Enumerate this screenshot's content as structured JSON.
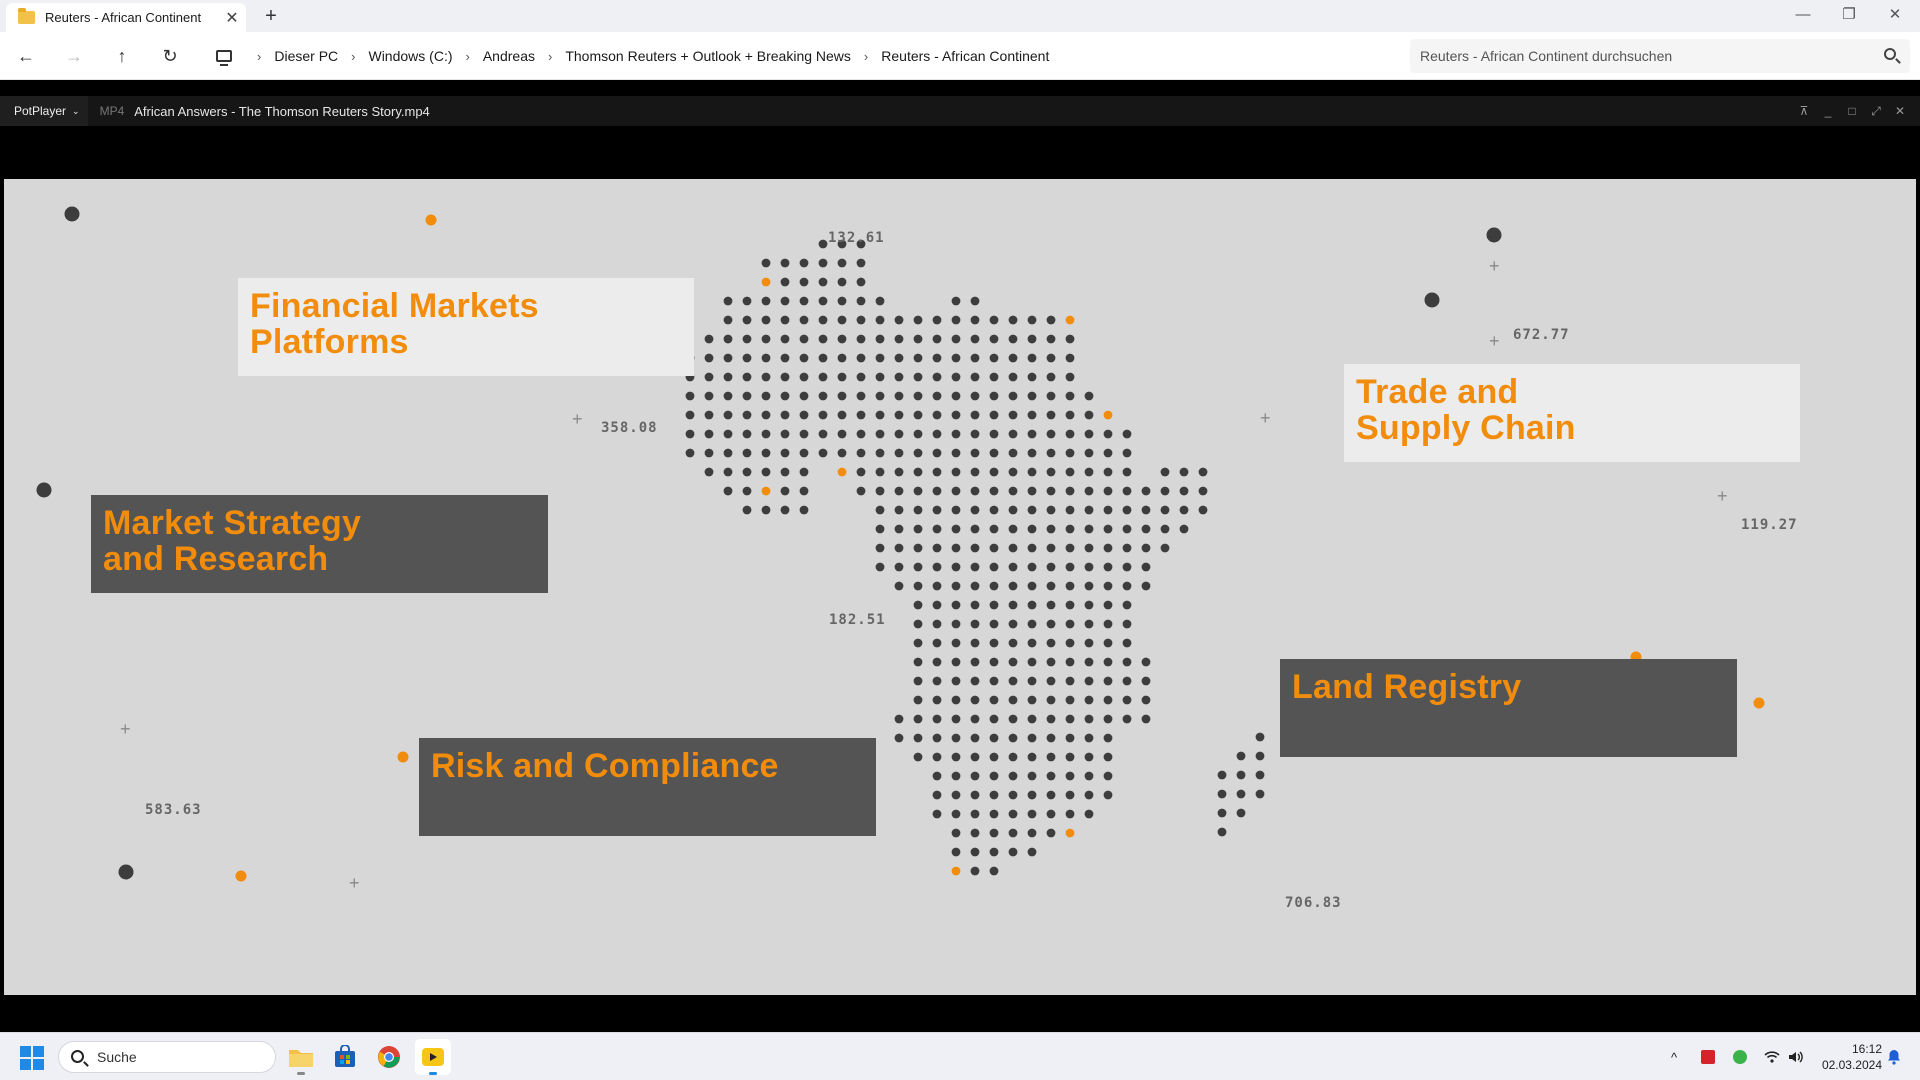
{
  "explorer": {
    "tab_title": "Reuters - African Continent",
    "tab_close": "✕",
    "new_tab": "+",
    "window": {
      "minimize": "—",
      "restore": "❐",
      "close": "✕"
    },
    "nav": {
      "back": "←",
      "forward": "→",
      "up": "↑",
      "refresh": "↻"
    },
    "breadcrumbs": [
      "Dieser PC",
      "Windows (C:)",
      "Andreas",
      "Thomson Reuters + Outlook + Breaking News",
      "Reuters - African Continent"
    ],
    "breadcrumb_sep": "›",
    "search_placeholder": "Reuters - African Continent durchsuchen"
  },
  "player": {
    "menu_label": "PotPlayer",
    "menu_caret": "⌄",
    "format": "MP4",
    "file_name": "African Answers - The Thomson Reuters Story.mp4",
    "controls": {
      "pin": "⊼",
      "minimize": "_",
      "maximize": "□",
      "fullscreen": "⤢",
      "close": "✕"
    }
  },
  "video": {
    "labels": {
      "financial_line1": "Financial Markets",
      "financial_line2": "Platforms",
      "trade_line1": "Trade and",
      "trade_line2": "Supply Chain",
      "strategy_line1": "Market Strategy",
      "strategy_line2": "and Research",
      "land": "Land Registry",
      "risk": "Risk and Compliance"
    },
    "numbers": {
      "n1": "132.61",
      "n2": "358.08",
      "n3": "672.77",
      "n4": "119.27",
      "n5": "182.51",
      "n6": "583.63",
      "n7": "706.83"
    },
    "plus_glyph": "+",
    "colors": {
      "orange": "#f28c0c",
      "dot": "#3d3d3d",
      "bg": "#d7d7d7"
    }
  },
  "taskbar": {
    "search_label": "Suche",
    "tray_chevron": "^",
    "time": "16:12",
    "date": "02.03.2024"
  }
}
